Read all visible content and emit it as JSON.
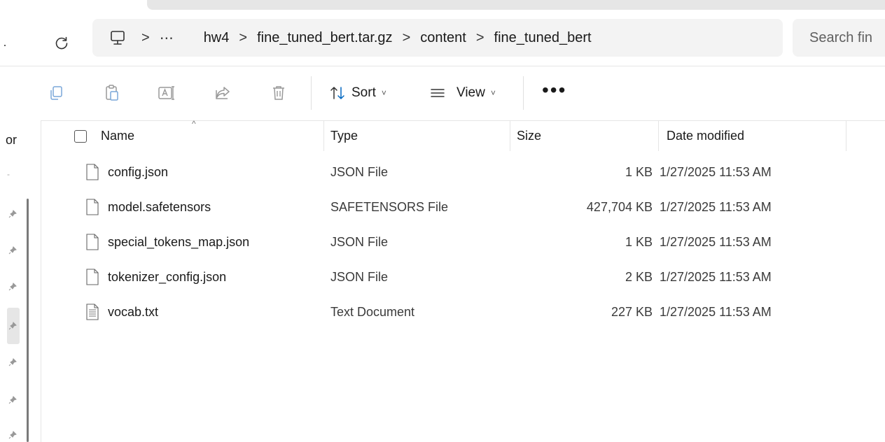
{
  "address": {
    "more": "⋯",
    "crumbs": [
      "hw4",
      "fine_tuned_bert.tar.gz",
      "content",
      "fine_tuned_bert"
    ],
    "separator": ">",
    "search_placeholder": "Search fin"
  },
  "toolbar": {
    "sort_label": "Sort",
    "view_label": "View",
    "more_label": "•••",
    "caret": "˅"
  },
  "nav": {
    "partial_label": "or",
    "dash": "-"
  },
  "columns": {
    "name": "Name",
    "type": "Type",
    "size": "Size",
    "date": "Date modified",
    "sort_indicator": "^"
  },
  "files": [
    {
      "name": "config.json",
      "type": "JSON File",
      "size": "1 KB",
      "date": "1/27/2025 11:53 AM",
      "icon": "file-icon"
    },
    {
      "name": "model.safetensors",
      "type": "SAFETENSORS File",
      "size": "427,704 KB",
      "date": "1/27/2025 11:53 AM",
      "icon": "file-icon"
    },
    {
      "name": "special_tokens_map.json",
      "type": "JSON File",
      "size": "1 KB",
      "date": "1/27/2025 11:53 AM",
      "icon": "file-icon"
    },
    {
      "name": "tokenizer_config.json",
      "type": "JSON File",
      "size": "2 KB",
      "date": "1/27/2025 11:53 AM",
      "icon": "file-icon"
    },
    {
      "name": "vocab.txt",
      "type": "Text Document",
      "size": "227 KB",
      "date": "1/27/2025 11:53 AM",
      "icon": "text-document-icon"
    }
  ],
  "colors": {
    "accent": "#0067c0",
    "breadcrumb_bg": "#f3f3f3",
    "icon_gray": "#7a7a7a"
  }
}
